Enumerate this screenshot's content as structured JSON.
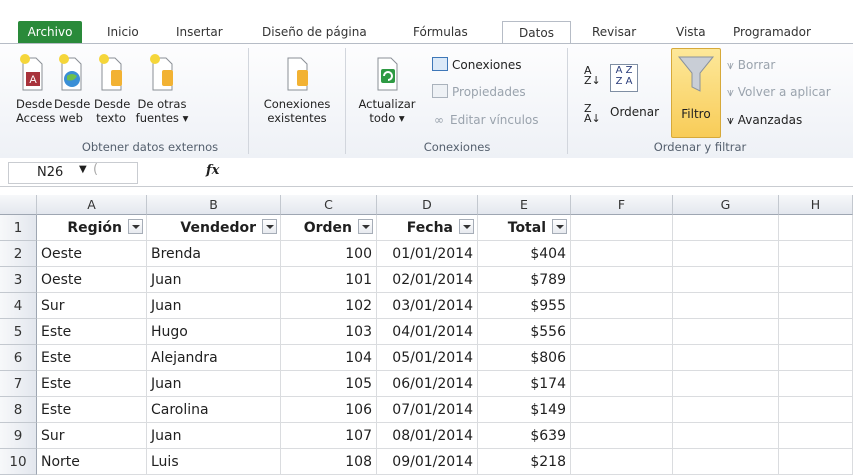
{
  "tabs": [
    "Archivo",
    "Inicio",
    "Insertar",
    "Diseño de página",
    "Fórmulas",
    "Datos",
    "Revisar",
    "Vista",
    "Programador"
  ],
  "ribbon": {
    "get_external": {
      "buttons": [
        {
          "line1": "Desde",
          "line2": "Access",
          "icon": "access-db-icon"
        },
        {
          "line1": "Desde",
          "line2": "web",
          "icon": "web-globe-icon"
        },
        {
          "line1": "Desde",
          "line2": "texto",
          "icon": "text-file-icon"
        },
        {
          "line1": "De otras",
          "line2": "fuentes ▾",
          "icon": "other-sources-icon"
        }
      ],
      "label": "Obtener datos externos"
    },
    "existing": {
      "line1": "Conexiones",
      "line2": "existentes",
      "icon": "existing-connections-icon"
    },
    "connections": {
      "refresh": {
        "line1": "Actualizar",
        "line2": "todo ▾",
        "icon": "refresh-icon"
      },
      "items": [
        "Conexiones",
        "Propiedades",
        "Editar vínculos"
      ],
      "label": "Conexiones"
    },
    "sort_filter": {
      "sort_label": "Ordenar",
      "filter_label": "Filtro",
      "clear": "Borrar",
      "reapply": "Volver a aplicar",
      "advanced": "Avanzadas",
      "label": "Ordenar y filtrar"
    }
  },
  "formula_bar": {
    "name_box": "N26",
    "fx": "fx",
    "formula": ""
  },
  "grid": {
    "columns": [
      "A",
      "B",
      "C",
      "D",
      "E",
      "F",
      "G",
      "H"
    ],
    "headers": [
      "Región",
      "Vendedor",
      "Orden",
      "Fecha",
      "Total"
    ],
    "rows": [
      [
        "Oeste",
        "Brenda",
        "100",
        "01/01/2014",
        "$404"
      ],
      [
        "Oeste",
        "Juan",
        "101",
        "02/01/2014",
        "$789"
      ],
      [
        "Sur",
        "Juan",
        "102",
        "03/01/2014",
        "$955"
      ],
      [
        "Este",
        "Hugo",
        "103",
        "04/01/2014",
        "$556"
      ],
      [
        "Este",
        "Alejandra",
        "104",
        "05/01/2014",
        "$806"
      ],
      [
        "Este",
        "Juan",
        "105",
        "06/01/2014",
        "$174"
      ],
      [
        "Este",
        "Carolina",
        "106",
        "07/01/2014",
        "$149"
      ],
      [
        "Sur",
        "Juan",
        "107",
        "08/01/2014",
        "$639"
      ],
      [
        "Norte",
        "Luis",
        "108",
        "09/01/2014",
        "$218"
      ]
    ],
    "row_numbers": [
      "1",
      "2",
      "3",
      "4",
      "5",
      "6",
      "7",
      "8",
      "9",
      "10"
    ]
  }
}
